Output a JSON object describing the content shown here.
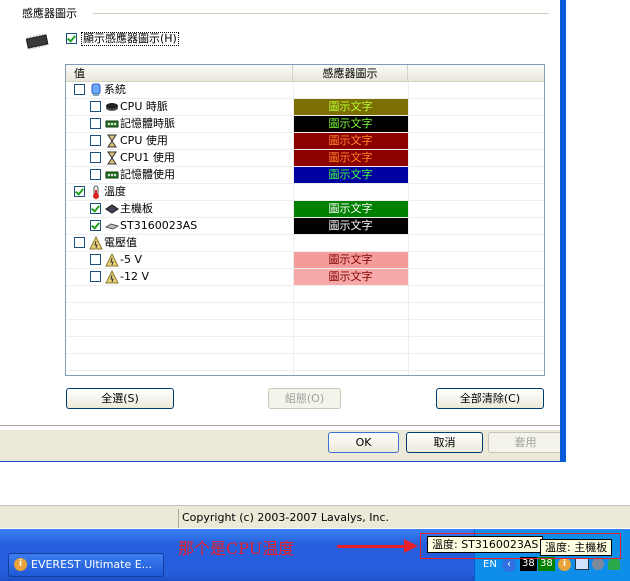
{
  "dialog": {
    "group_title": "感應器圖示",
    "show_checkbox_label": "顯示感應器圖示(H)",
    "show_checked": true,
    "columns": [
      "值",
      "感應器圖示"
    ],
    "rows": [
      {
        "label": "系統",
        "indent": 0,
        "checked": false,
        "icon": "computer-icon",
        "swatch": null
      },
      {
        "label": "CPU 時脈",
        "indent": 1,
        "checked": false,
        "icon": "cpu-icon",
        "swatch": {
          "text": "圖示文字",
          "bg": "#7a6f00",
          "fg": "#b9ff39"
        }
      },
      {
        "label": "記憶體時脈",
        "indent": 1,
        "checked": false,
        "icon": "memory-icon",
        "swatch": {
          "text": "圖示文字",
          "bg": "#000000",
          "fg": "#7cff3b"
        }
      },
      {
        "label": "CPU 使用",
        "indent": 1,
        "checked": false,
        "icon": "hourglass-icon",
        "swatch": {
          "text": "圖示文字",
          "bg": "#8c0000",
          "fg": "#ff8a2a"
        }
      },
      {
        "label": "CPU1 使用",
        "indent": 1,
        "checked": false,
        "icon": "hourglass-icon",
        "swatch": {
          "text": "圖示文字",
          "bg": "#8c0000",
          "fg": "#ff8a2a"
        }
      },
      {
        "label": "記憶體使用",
        "indent": 1,
        "checked": false,
        "icon": "memory-icon",
        "swatch": {
          "text": "圖示文字",
          "bg": "#0000a0",
          "fg": "#3cff3c"
        }
      },
      {
        "label": "溫度",
        "indent": 0,
        "checked": true,
        "icon": "thermometer-icon",
        "swatch": null
      },
      {
        "label": "主機板",
        "indent": 1,
        "checked": true,
        "icon": "motherboard-icon",
        "swatch": {
          "text": "圖示文字",
          "bg": "#008000",
          "fg": "#ffffff"
        }
      },
      {
        "label": "ST3160023AS",
        "indent": 1,
        "checked": true,
        "icon": "harddisk-icon",
        "swatch": {
          "text": "圖示文字",
          "bg": "#000000",
          "fg": "#ffffff"
        }
      },
      {
        "label": "電壓值",
        "indent": 0,
        "checked": false,
        "icon": "voltage-icon",
        "swatch": null
      },
      {
        "label": "-5 V",
        "indent": 1,
        "checked": false,
        "icon": "voltage-icon",
        "swatch": {
          "text": "圖示文字",
          "bg": "#f49b9b",
          "fg": "#800000"
        }
      },
      {
        "label": "-12 V",
        "indent": 1,
        "checked": false,
        "icon": "voltage-icon",
        "swatch": {
          "text": "圖示文字",
          "bg": "#f7a9a9",
          "fg": "#800000"
        }
      }
    ],
    "buttons": {
      "select_all": "全選(S)",
      "config": "組態(O)",
      "clear_all": "全部清除(C)",
      "ok": "OK",
      "cancel": "取消",
      "apply": "套用"
    }
  },
  "status": {
    "copyright": "Copyright (c) 2003-2007 Lavalys, Inc."
  },
  "taskbar": {
    "task_label": "EVEREST Ultimate E...",
    "language": "EN",
    "tray_temp1": "38",
    "tray_temp2": "38",
    "tooltip_hdd": "溫度: ST3160023AS",
    "tooltip_board": "溫度: 主機板"
  },
  "annotation": {
    "text": "那个是CPU温度",
    "color": "#e8202a"
  }
}
